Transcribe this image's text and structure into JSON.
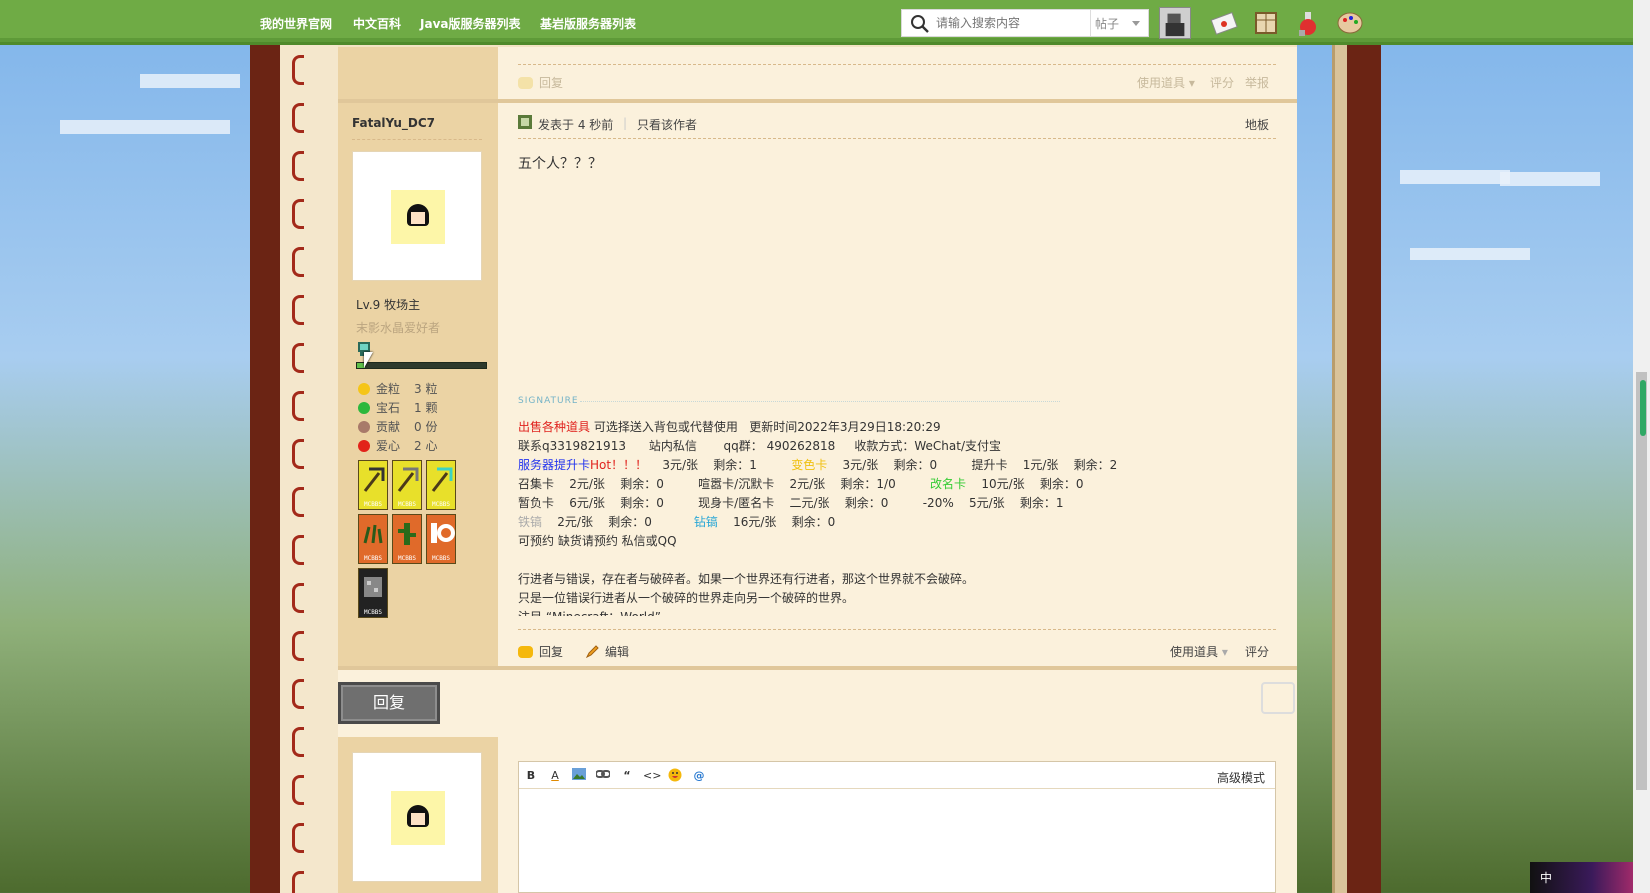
{
  "topbar": {
    "nav": [
      {
        "label": "我的世界官网"
      },
      {
        "label": "中文百科"
      },
      {
        "label": "Java版服务器列表"
      },
      {
        "label": "基岩版服务器列表"
      }
    ],
    "search_placeholder": "请输入搜索内容",
    "search_type": "帖子"
  },
  "prev_post": {
    "reply": "回复",
    "tools": "使用道具",
    "rate": "评分",
    "report": "举报"
  },
  "post": {
    "author": "FatalYu_DC7",
    "posted": "发表于 4 秒前",
    "only_author": "只看该作者",
    "floor": "地板",
    "content": "五个人？？？",
    "level": "Lv.9 牧场主",
    "user_title": "末影水晶爱好者",
    "progress": 0.06,
    "stats": [
      {
        "label": "金粒",
        "value": "3 粒",
        "color": "#f5c518"
      },
      {
        "label": "宝石",
        "value": "1 颗",
        "color": "#2db83d"
      },
      {
        "label": "贡献",
        "value": "0 份",
        "color": "#a87a6a"
      },
      {
        "label": "爱心",
        "value": "2 心",
        "color": "#e2231a"
      }
    ],
    "medals": [
      "MCBBS",
      "MCBBS",
      "MCBBS",
      "MCBBS",
      "MCBBS",
      "MCBBS",
      "MCBBS"
    ],
    "signature_label": "SIGNATURE",
    "signature": {
      "l1a": "出售各种道具",
      "l1b": " 可选择送入背包或代替使用   更新时间2022年3月29日18:20:29",
      "l2": "联系q3319821913      站内私信       qq群： 490262818     收款方式：WeChat/支付宝",
      "l3a": "服务器提升卡",
      "l3b": "Hot！！！",
      "l3c": "    3元/张    剩余：1         ",
      "l3d": "变色卡",
      "l3e": "    3元/张    剩余：0         提升卡    1元/张    剩余：2",
      "l4a": "召集卡    2元/张    剩余：0         喧嚣卡/沉默卡    2元/张    剩余：1/0         ",
      "l4b": "改名卡",
      "l4c": "    10元/张    剩余：0",
      "l5": "暂负卡    6元/张    剩余：0         现身卡/匿名卡    二元/张    剩余：0         -20%    5元/张    剩余：1",
      "l6a": "铁镐",
      "l6b": "    2元/张    剩余：0           ",
      "l6c": "钻镐",
      "l6d": "    16元/张    剩余：0",
      "l7": "可预约 缺货请预约 私信或QQ",
      "l8": "",
      "l9": "行进者与错误，存在者与破碎者。如果一个世界还有行进者，那这个世界就不会破碎。",
      "l10": "只是一位错误行进者从一个破碎的世界走向另一个破碎的世界。",
      "l11": "注目 “Minecraft：World”"
    },
    "actions": {
      "reply": "回复",
      "edit": "编辑",
      "tools": "使用道具",
      "rate": "评分"
    }
  },
  "reply_button": "回复",
  "editor": {
    "buttons": [
      "B",
      "A",
      "",
      "",
      "“",
      "<>",
      "",
      "@"
    ],
    "advanced": "高级模式"
  },
  "ime": "中"
}
